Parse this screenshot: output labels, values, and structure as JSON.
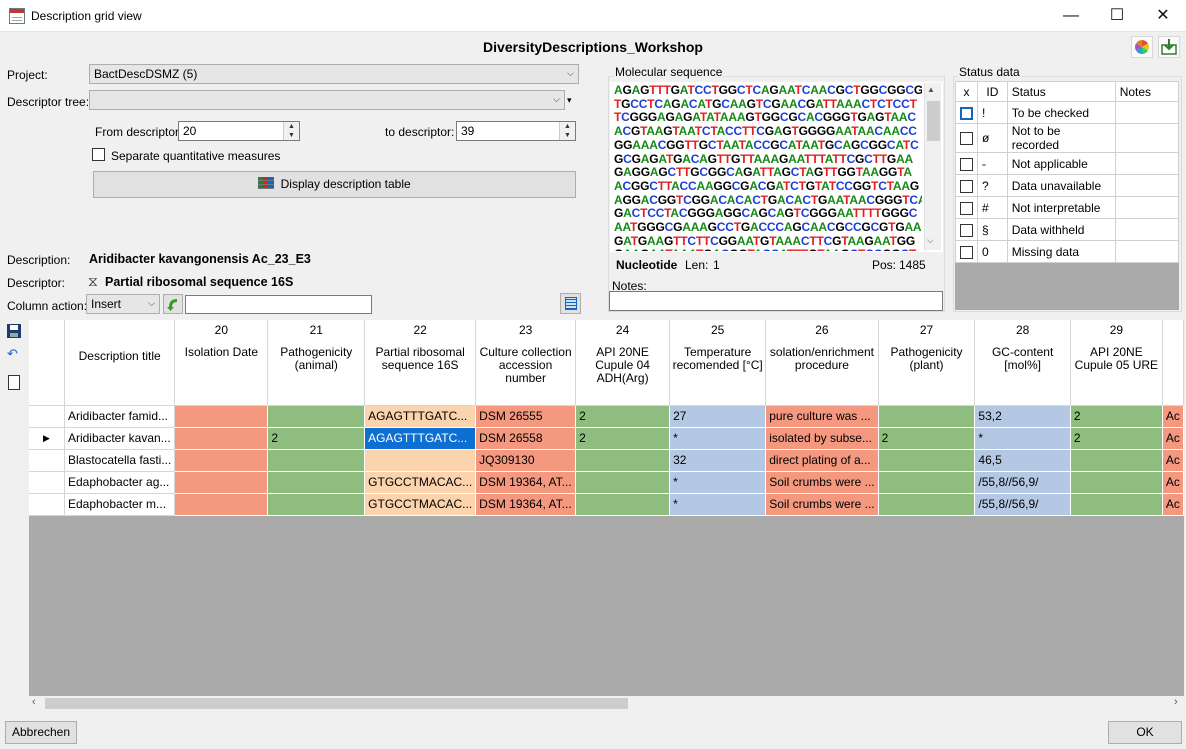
{
  "window": {
    "title": "Description grid view",
    "minimize_glyph": "—",
    "maximize_glyph": "☐",
    "close_glyph": "✕",
    "app_icon": "table-app-icon"
  },
  "database_title": "DiversityDescriptions_Workshop",
  "toolbar_icons": [
    "color-wheel-icon",
    "export-icon"
  ],
  "filters": {
    "project_label": "Project:",
    "project_value": "BactDescDSMZ (5)",
    "descriptor_tree_label": "Descriptor tree:",
    "descriptor_tree_value": "",
    "from_label": "From descriptor:",
    "from_value": "20",
    "to_label": "to descriptor:",
    "to_value": "39",
    "separate_quantitative_label": "Separate quantitative measures",
    "display_button_label": "Display description table"
  },
  "current": {
    "description_label": "Description:",
    "description_value": "Aridibacter kavangonensis Ac_23_E3",
    "descriptor_label": "Descriptor:",
    "descriptor_value": "Partial ribosomal sequence 16S",
    "column_action_label": "Column action:",
    "column_action_value": "Insert",
    "column_action_text": ""
  },
  "molecular": {
    "group_label": "Molecular sequence",
    "lines": [
      "AGAGTTTGATCCTGGCTCAGAATCAACGCTGGCGGCG",
      "TGCCTCAGACATGCAAGTCGAACGATTAAACTCTCCT",
      "TCGGGAGAGATATAAAGTGGCGCACGGGTGAGTAAC",
      "ACGTAAGTAATCTACCTTCGAGTGGGGAATAACAACC",
      "GGAAACGGTTGCTAATACCGCATAATGCAGCGGCATC",
      "GCGAGATGACAGTTGTTAAAGAATTTATTCGCTTGAA",
      "GAGGAGCTTGCGGCAGATTAGCTAGTTGGTAAGGTA",
      "ACGGCTTACCAAGGCGACGATCTGTATCCGGTCTAAG",
      "AGGACGGTCGGACACACTGACACTGAATAACGGGTCA",
      "GACTCCTACGGGAGGCAGCAGTCGGGAATTTTGGGC",
      "AATGGGCGAAAGCCTGACCCAGCAACGCCGCGTGAAG",
      "GATGAAGTTCTTCGGAATGTAAACTTCGTAAGAATGG",
      "GAAGAATAAATGACGGTACCATTTGTAAGCTCCGGCT"
    ],
    "type_label": "Nucleotide",
    "len_label": "Len:",
    "len_value": "1",
    "pos_label": "Pos:",
    "pos_value": "1485",
    "notes_label": "Notes:",
    "notes_value": ""
  },
  "status": {
    "group_label": "Status data",
    "headers": [
      "x",
      "ID",
      "Status",
      "Notes"
    ],
    "rows": [
      {
        "id": "!",
        "status": "To be checked"
      },
      {
        "id": "ø",
        "status": "Not to be recorded"
      },
      {
        "id": "-",
        "status": "Not applicable"
      },
      {
        "id": "?",
        "status": "Data unavailable"
      },
      {
        "id": "#",
        "status": "Not interpretable"
      },
      {
        "id": "§",
        "status": "Data withheld"
      },
      {
        "id": "0",
        "status": "Missing data"
      }
    ]
  },
  "side_tools": [
    "save-icon",
    "undo-icon",
    "new-document-icon"
  ],
  "grid": {
    "title_header": "Description title",
    "columns": [
      {
        "num": "20",
        "name": "Isolation Date"
      },
      {
        "num": "21",
        "name": "Pathogenicity (animal)"
      },
      {
        "num": "22",
        "name": "Partial ribosomal sequence 16S"
      },
      {
        "num": "23",
        "name": "Culture collection accession number"
      },
      {
        "num": "24",
        "name": "API 20NE Cupule 04 ADH(Arg)"
      },
      {
        "num": "25",
        "name": "Temperature recomended [°C]"
      },
      {
        "num": "26",
        "name": "solation/enrichment procedure"
      },
      {
        "num": "27",
        "name": "Pathogenicity (plant)"
      },
      {
        "num": "28",
        "name": "GC-content [mol%]"
      },
      {
        "num": "29",
        "name": "API 20NE Cupule 05 URE"
      },
      {
        "num": "",
        "name": ""
      }
    ],
    "rows": [
      {
        "current": false,
        "title": "Aridibacter famid...",
        "cells": [
          "",
          "",
          "AGAGTTTGATC...",
          "DSM 26555",
          "2",
          "27",
          "pure culture was ...",
          "",
          "53,2",
          "2",
          "Ac"
        ]
      },
      {
        "current": true,
        "title": "Aridibacter kavan...",
        "cells": [
          "",
          "2",
          "AGAGTTTGATC...",
          "DSM 26558",
          "2",
          "*",
          "isolated by subse...",
          "2",
          "*",
          "2",
          "Ac"
        ]
      },
      {
        "current": false,
        "title": "Blastocatella fasti...",
        "cells": [
          "",
          "",
          "",
          "JQ309130",
          "",
          "32",
          "direct plating of a...",
          "",
          "46,5",
          "",
          "Ac"
        ]
      },
      {
        "current": false,
        "title": "Edaphobacter ag...",
        "cells": [
          "",
          "",
          "GTGCCTMACAC...",
          "DSM 19364, AT...",
          "",
          "*",
          "Soil crumbs were ...",
          "",
          "/55,8//56,9/",
          "",
          "Ac"
        ]
      },
      {
        "current": false,
        "title": "Edaphobacter m...",
        "cells": [
          "",
          "",
          "GTGCCTMACAC...",
          " DSM 19364, AT...",
          "",
          "*",
          "Soil crumbs were ...",
          "",
          "/55,8//56,9/",
          "",
          "Ac"
        ]
      }
    ],
    "row_indicator": "▶"
  },
  "footer": {
    "cancel_label": "Abbrechen",
    "ok_label": "OK"
  },
  "colors": {
    "text_cell": "#f4997f",
    "categorical_cell": "#8fbd7f",
    "sequence_cell": "#fbd3ad",
    "quantitative_cell": "#b4c8e4",
    "selection": "#0d6fd1",
    "empty_grid": "#aaaaaa"
  }
}
